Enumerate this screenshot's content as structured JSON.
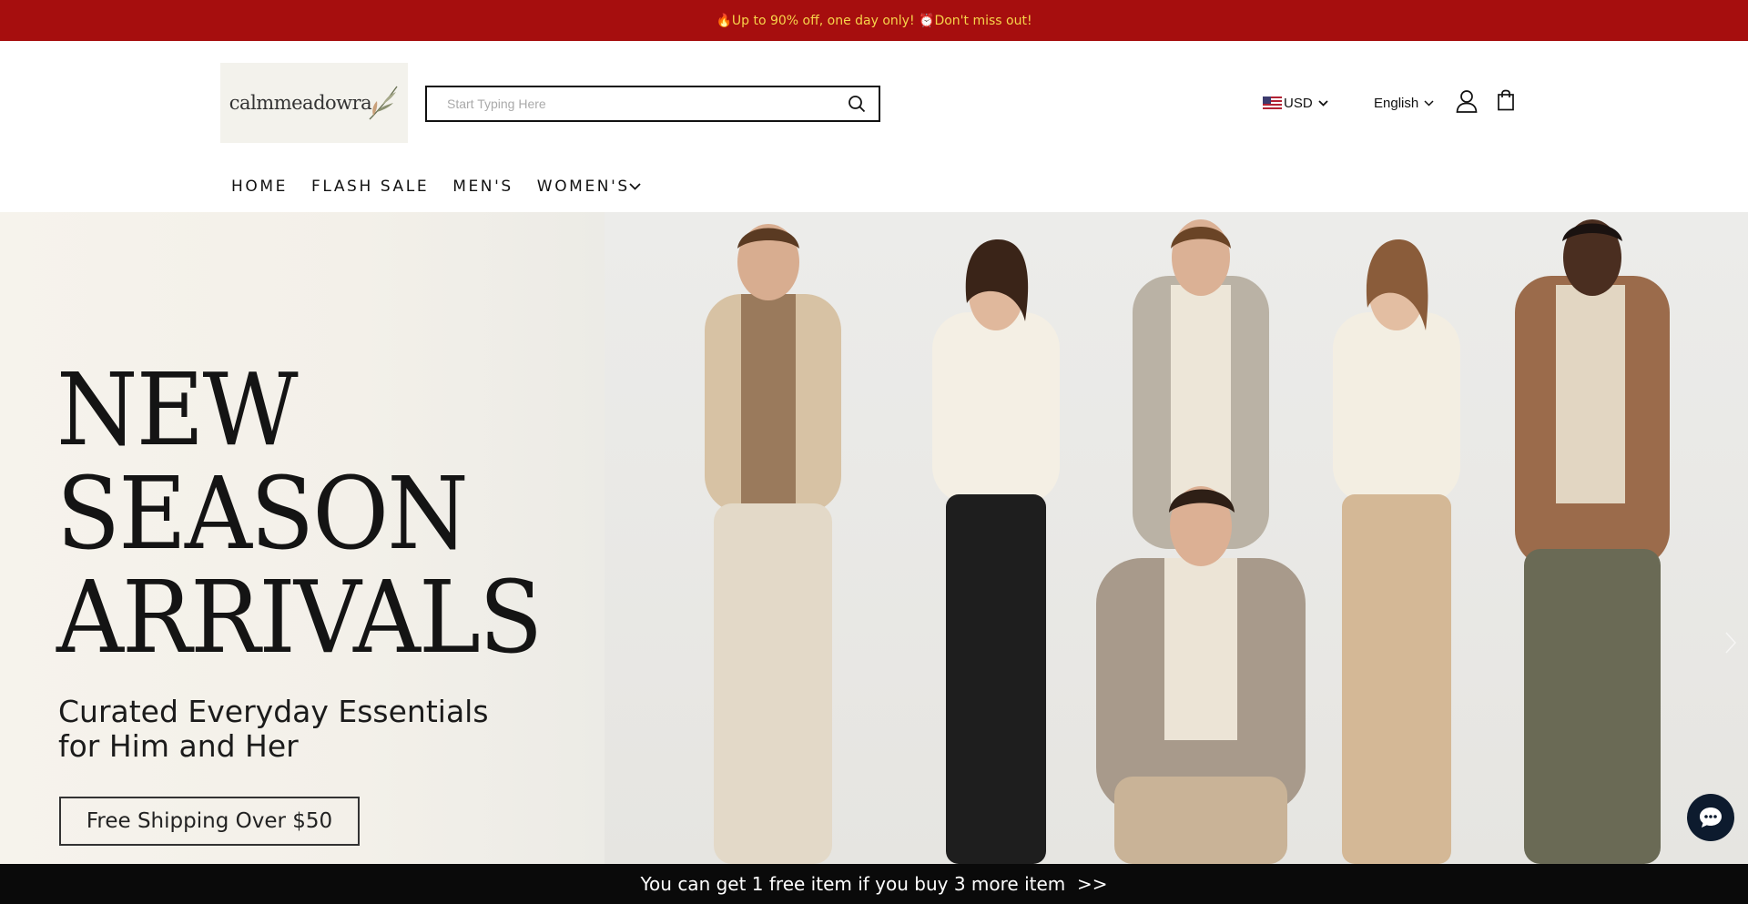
{
  "announcement": {
    "text": "🔥Up to 90% off, one day only! ⏰Don't miss out!"
  },
  "header": {
    "logo_text": "calmmeadowra",
    "search": {
      "placeholder": "Start Typing Here",
      "value": "",
      "icon": "search-icon"
    },
    "currency": {
      "label": "USD",
      "flag_icon": "us-flag-icon"
    },
    "language": {
      "label": "English"
    },
    "icons": {
      "account": "user-icon",
      "cart": "bag-icon"
    }
  },
  "nav": {
    "items": [
      {
        "label": "HOME"
      },
      {
        "label": "FLASH SALE"
      },
      {
        "label": "MEN'S"
      },
      {
        "label": "WOMEN'S"
      }
    ]
  },
  "hero": {
    "headline_line1": "NEW",
    "headline_line2": "SEASON",
    "headline_line3": "ARRIVALS",
    "subline1": "Curated Everyday Essentials",
    "subline2": "for Him and Her",
    "shipping_label": "Free Shipping Over $50"
  },
  "chat": {
    "icon": "chat-bubble-icon"
  },
  "bottom_bar": {
    "text": "You can get 1 free item if you buy 3 more item  >>"
  },
  "colors": {
    "announcement_bg": "#a60e0e",
    "announcement_text": "#f7d44a",
    "bottom_bar_bg": "#0a0a0a",
    "chat_bg": "#0d1b2e"
  }
}
